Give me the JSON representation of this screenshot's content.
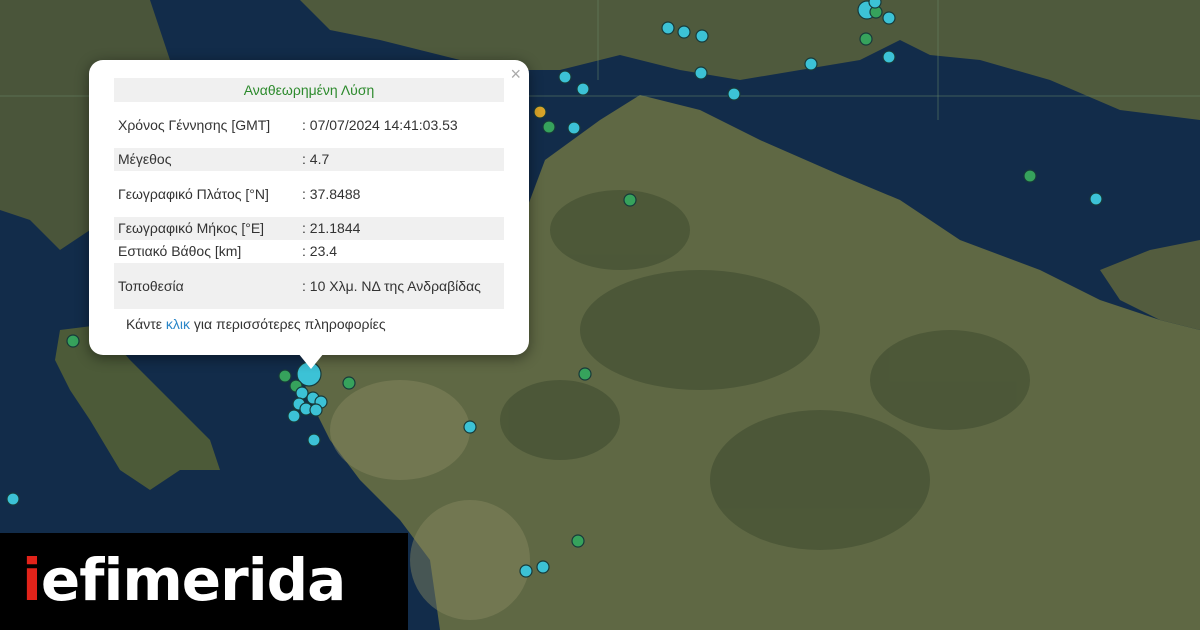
{
  "popup": {
    "title": "Αναθεωρημένη Λύση",
    "close_label": "×",
    "rows": [
      {
        "key": "Χρόνος Γέννησης [GMT]",
        "value": ": 07/07/2024 14:41:03.53"
      },
      {
        "key": "Μέγεθος",
        "value": ": 4.7"
      },
      {
        "key": "Γεωγραφικό Πλάτος [°N]",
        "value": ": 37.8488"
      },
      {
        "key": "Γεωγραφικό Μήκος [°E]",
        "value": ": 21.1844"
      },
      {
        "key": "Εστιακό Βάθος [km]",
        "value": ": 23.4"
      },
      {
        "key": "Τοποθεσία",
        "value": ": 10 Χλμ. ΝΔ της Ανδραβίδας"
      }
    ],
    "more_prefix": "Κάντε ",
    "more_link": "κλικ",
    "more_suffix": " για περισσότερες πληροφορίες"
  },
  "logo": {
    "i": "i",
    "rest": "efimerida"
  },
  "colors": {
    "marker_cyan": "#3cc2d6",
    "marker_green": "#36a25c",
    "marker_orange": "#d9a429",
    "sea": "#0f2a4a",
    "land": "#5c6540"
  }
}
